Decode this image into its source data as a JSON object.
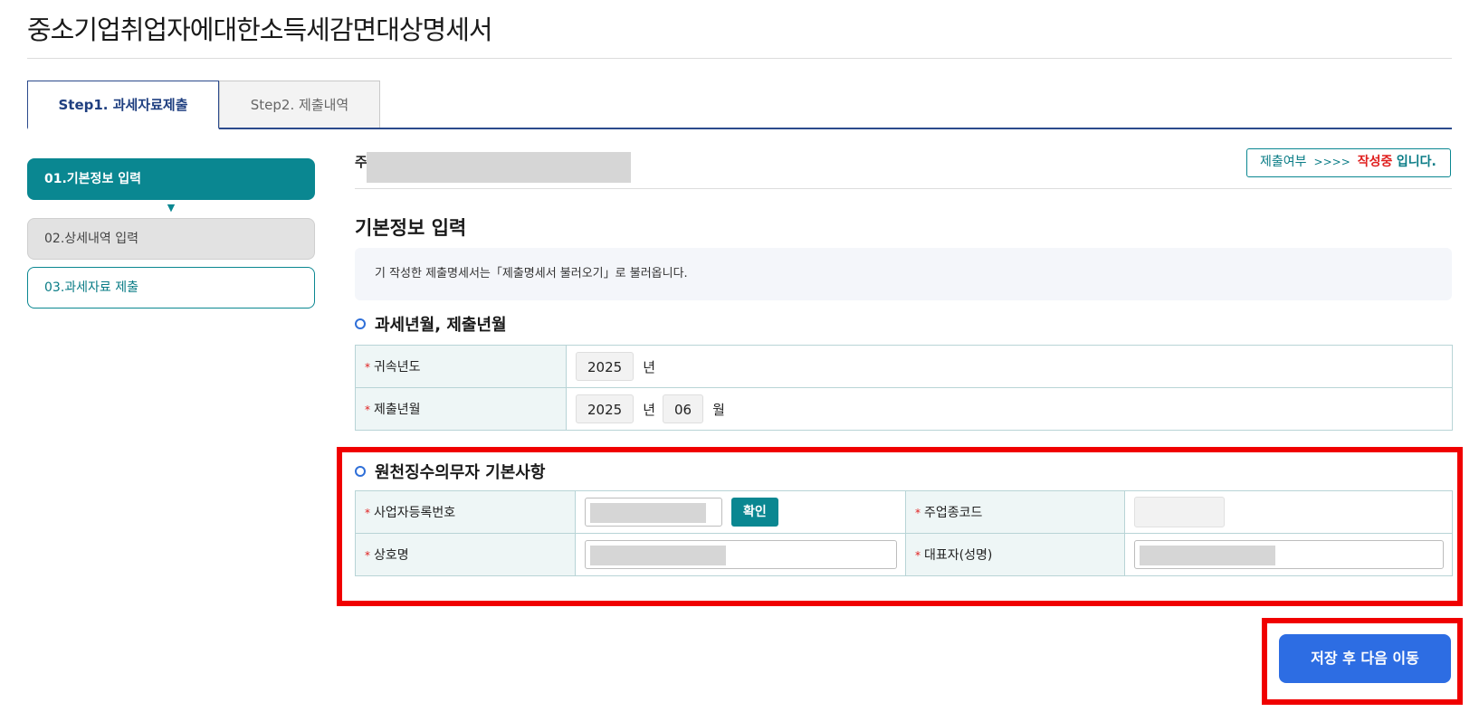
{
  "page": {
    "title": "중소기업취업자에대한소득세감면대상명세서"
  },
  "tabs": [
    {
      "label": "Step1. 과세자료제출",
      "active": true
    },
    {
      "label": "Step2. 제출내역",
      "active": false
    }
  ],
  "steps": [
    {
      "label": "01.기본정보 입력",
      "state": "current"
    },
    {
      "label": "02.상세내역 입력",
      "state": "disabled"
    },
    {
      "label": "03.과세자료 제출",
      "state": "pending"
    }
  ],
  "user": {
    "prefix": "주"
  },
  "status": {
    "label": "제출여부",
    "arrow": ">>>>",
    "value": "작성중",
    "suffix": "입니다."
  },
  "section": {
    "title": "기본정보 입력",
    "notice": "기 작성한 제출명세서는「제출명세서 불러오기」로 불러옵니다."
  },
  "tax_period": {
    "title": "과세년월, 제출년월",
    "rows": [
      {
        "label": "귀속년도",
        "year": "2025",
        "year_unit": "년"
      },
      {
        "label": "제출년월",
        "year": "2025",
        "year_unit": "년",
        "month": "06",
        "month_unit": "월"
      }
    ]
  },
  "withholder": {
    "title": "원천징수의무자 기본사항",
    "brn_label": "사업자등록번호",
    "confirm_label": "확인",
    "industry_label": "주업종코드",
    "company_label": "상호명",
    "rep_label": "대표자(성명)"
  },
  "actions": {
    "save_next": "저장 후 다음 이동"
  },
  "colors": {
    "teal": "#0a8791",
    "navy": "#2b4a8c",
    "blue": "#2d6de3",
    "red": "#e0201f",
    "highlight": "#f00000"
  }
}
